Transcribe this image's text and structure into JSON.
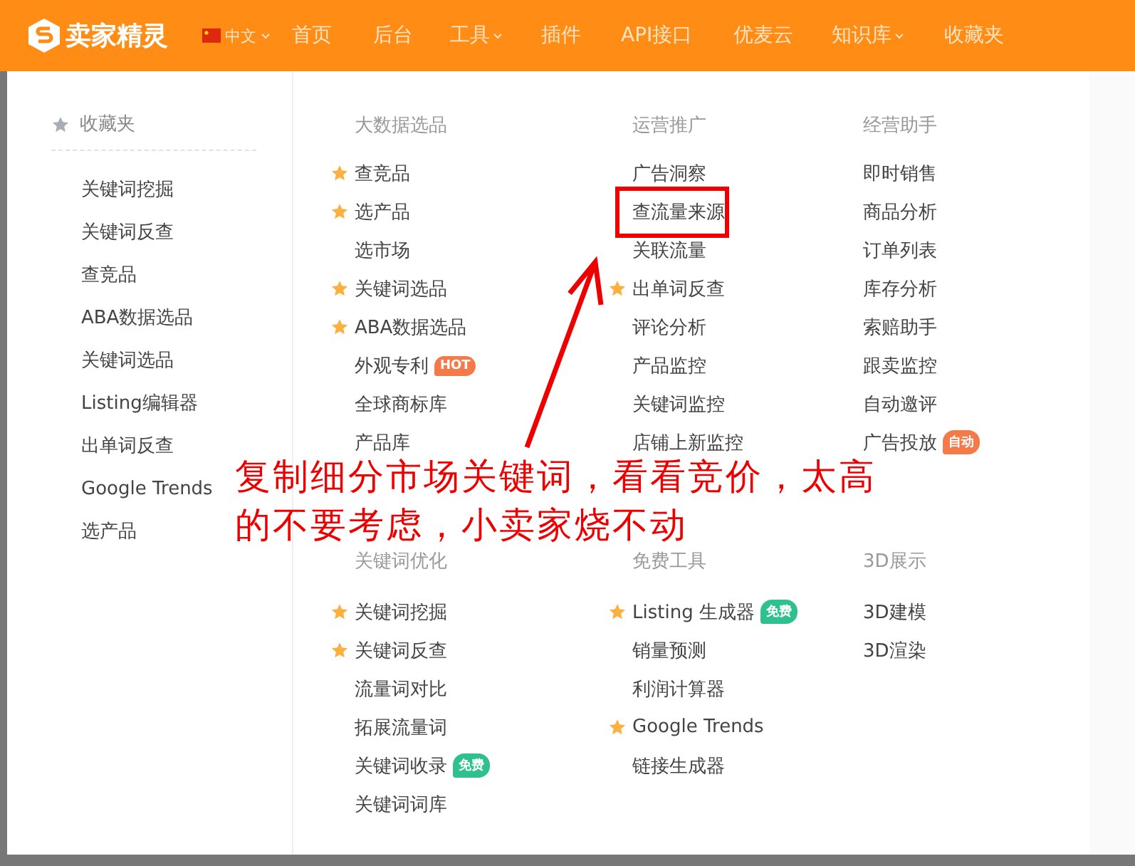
{
  "header": {
    "logo": "卖家精灵",
    "language": "中文",
    "nav": [
      {
        "label": "首页",
        "dropdown": false
      },
      {
        "label": "后台",
        "dropdown": false
      },
      {
        "label": "工具",
        "dropdown": true
      },
      {
        "label": "插件",
        "dropdown": false
      },
      {
        "label": "API接口",
        "dropdown": false
      },
      {
        "label": "优麦云",
        "dropdown": false
      },
      {
        "label": "知识库",
        "dropdown": true
      },
      {
        "label": "收藏夹",
        "dropdown": false
      }
    ]
  },
  "favorites": {
    "title": "收藏夹",
    "items": [
      "关键词挖掘",
      "关键词反查",
      "查竞品",
      "ABA数据选品",
      "关键词选品",
      "Listing编辑器",
      "出单词反查",
      "Google Trends",
      "选产品"
    ]
  },
  "sections": [
    {
      "columns": [
        {
          "title": "大数据选品",
          "items": [
            {
              "label": "查竞品",
              "starred": true
            },
            {
              "label": "选产品",
              "starred": true
            },
            {
              "label": "选市场",
              "starred": false
            },
            {
              "label": "关键词选品",
              "starred": true
            },
            {
              "label": "ABA数据选品",
              "starred": true
            },
            {
              "label": "外观专利",
              "starred": false,
              "badge": {
                "text": "HOT",
                "kind": "hot"
              }
            },
            {
              "label": "全球商标库",
              "starred": false
            },
            {
              "label": "产品库",
              "starred": false
            }
          ]
        },
        {
          "title": "运营推广",
          "items": [
            {
              "label": "广告洞察",
              "starred": false
            },
            {
              "label": "查流量来源",
              "starred": false,
              "highlighted": true
            },
            {
              "label": "关联流量",
              "starred": false
            },
            {
              "label": "出单词反查",
              "starred": true
            },
            {
              "label": "评论分析",
              "starred": false
            },
            {
              "label": "产品监控",
              "starred": false
            },
            {
              "label": "关键词监控",
              "starred": false
            },
            {
              "label": "店铺上新监控",
              "starred": false
            }
          ]
        },
        {
          "title": "经营助手",
          "items": [
            {
              "label": "即时销售",
              "starred": false
            },
            {
              "label": "商品分析",
              "starred": false
            },
            {
              "label": "订单列表",
              "starred": false
            },
            {
              "label": "库存分析",
              "starred": false
            },
            {
              "label": "索赔助手",
              "starred": false
            },
            {
              "label": "跟卖监控",
              "starred": false
            },
            {
              "label": "自动邀评",
              "starred": false
            },
            {
              "label": "广告投放",
              "starred": false,
              "badge": {
                "text": "自动",
                "kind": "auto"
              }
            }
          ]
        }
      ]
    },
    {
      "columns": [
        {
          "title": "关键词优化",
          "items": [
            {
              "label": "关键词挖掘",
              "starred": true
            },
            {
              "label": "关键词反查",
              "starred": true
            },
            {
              "label": "流量词对比",
              "starred": false
            },
            {
              "label": "拓展流量词",
              "starred": false
            },
            {
              "label": "关键词收录",
              "starred": false,
              "badge": {
                "text": "免费",
                "kind": "free"
              }
            },
            {
              "label": "关键词词库",
              "starred": false
            }
          ]
        },
        {
          "title": "免费工具",
          "items": [
            {
              "label": "Listing 生成器",
              "starred": true,
              "badge": {
                "text": "免费",
                "kind": "free"
              }
            },
            {
              "label": "销量预测",
              "starred": false
            },
            {
              "label": "利润计算器",
              "starred": false
            },
            {
              "label": "Google Trends",
              "starred": true
            },
            {
              "label": "链接生成器",
              "starred": false
            }
          ]
        },
        {
          "title": "3D展示",
          "items": [
            {
              "label": "3D建模",
              "starred": false
            },
            {
              "label": "3D渲染",
              "starred": false
            }
          ]
        }
      ]
    }
  ],
  "annotation": {
    "lines": [
      "复制细分市场关键词，看看竞价，太高",
      "的不要考虑，小卖家烧不动"
    ]
  }
}
